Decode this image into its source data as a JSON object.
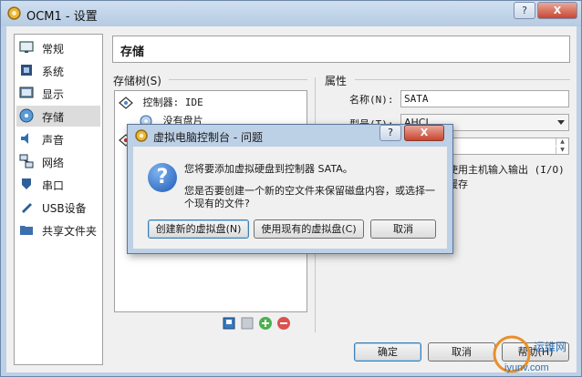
{
  "window": {
    "title": "OCM1 - 设置",
    "help_glyph": "?",
    "close_glyph": "X"
  },
  "sidebar": {
    "items": [
      {
        "label": "常规",
        "icon": "monitor-icon"
      },
      {
        "label": "系统",
        "icon": "chip-icon"
      },
      {
        "label": "显示",
        "icon": "display-icon"
      },
      {
        "label": "存储",
        "icon": "disk-icon",
        "selected": true
      },
      {
        "label": "声音",
        "icon": "speaker-icon"
      },
      {
        "label": "网络",
        "icon": "network-icon"
      },
      {
        "label": "串口",
        "icon": "serial-port-icon"
      },
      {
        "label": "USB设备",
        "icon": "usb-icon"
      },
      {
        "label": "共享文件夹",
        "icon": "folder-icon"
      }
    ]
  },
  "panel": {
    "title": "存储"
  },
  "storage_tree": {
    "label": "存储树(S)",
    "items": [
      {
        "label": "控制器: IDE",
        "icon": "ide-controller-icon"
      },
      {
        "label": "没有盘片",
        "icon": "optical-disc-icon"
      }
    ]
  },
  "attributes": {
    "label": "属性",
    "name_label": "名称(N):",
    "name_value": "SATA",
    "type_label": "型号(T):",
    "type_value": "AHCI",
    "cache_label": "使用主机输入输出 (I/O) 缓存"
  },
  "footer": {
    "ok": "确定",
    "cancel": "取消",
    "help": "帮助(H)"
  },
  "dialog": {
    "title": "虚拟电脑控制台 - 问题",
    "help_glyph": "?",
    "close_glyph": "X",
    "message_1": "您将要添加虚拟硬盘到控制器 SATA。",
    "message_2": "您是否要创建一个新的空文件来保留磁盘内容，或选择一个现有的文件?",
    "btn_create": "创建新的虚拟盘(N)",
    "btn_existing": "使用现有的虚拟盘(C)",
    "btn_cancel": "取消"
  },
  "watermark": {
    "text_top": "运维网",
    "text_bottom": "iyunv.com"
  }
}
